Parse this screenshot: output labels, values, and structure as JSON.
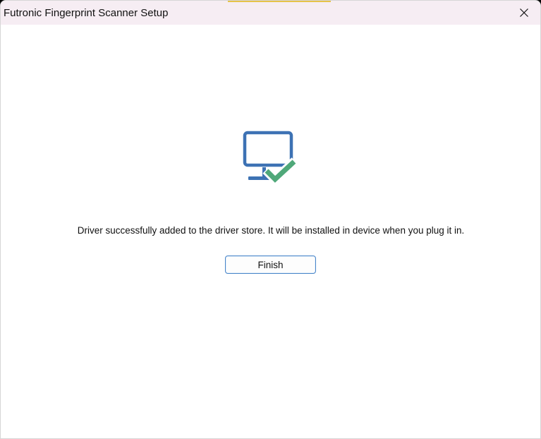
{
  "window": {
    "title": "Futronic Fingerprint Scanner Setup"
  },
  "titlebar": {
    "close_icon": "close-icon"
  },
  "content": {
    "status_icon": "monitor-checkmark-icon",
    "message": "Driver successfully added to the driver store. It will be installed in device when you plug it in.",
    "finish_label": "Finish"
  },
  "colors": {
    "monitor": "#3d72b4",
    "checkmark": "#4fa879",
    "button_border": "#4a86c9",
    "titlebar_bg": "#f6edf3"
  }
}
